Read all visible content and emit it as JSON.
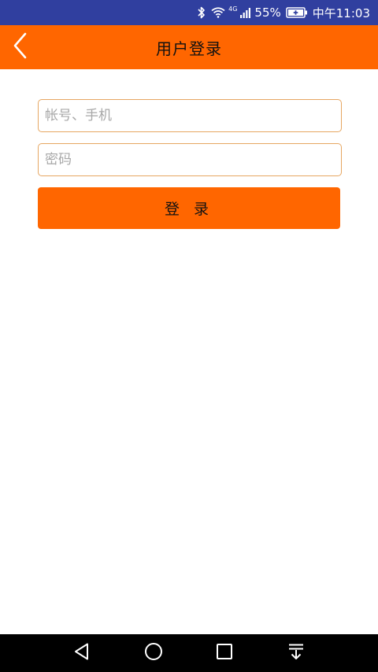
{
  "status_bar": {
    "network_type": "4G",
    "battery_percent": "55%",
    "time": "中午11:03",
    "background_color": "#303f9f",
    "icons": [
      "bluetooth-icon",
      "wifi-icon",
      "signal-icon",
      "battery-charging-icon"
    ]
  },
  "app_bar": {
    "title": "用户登录",
    "background_color": "#ff6600",
    "back_icon": "chevron-left-icon"
  },
  "form": {
    "account": {
      "placeholder": "帐号、手机",
      "value": ""
    },
    "password": {
      "placeholder": "密码",
      "value": ""
    },
    "border_color": "#e6a661",
    "login_button": {
      "label": "登 录",
      "color": "#ff6600"
    }
  },
  "nav_bar": {
    "icons": [
      "back-triangle-icon",
      "home-circle-icon",
      "recents-square-icon",
      "notification-pulldown-icon"
    ]
  }
}
